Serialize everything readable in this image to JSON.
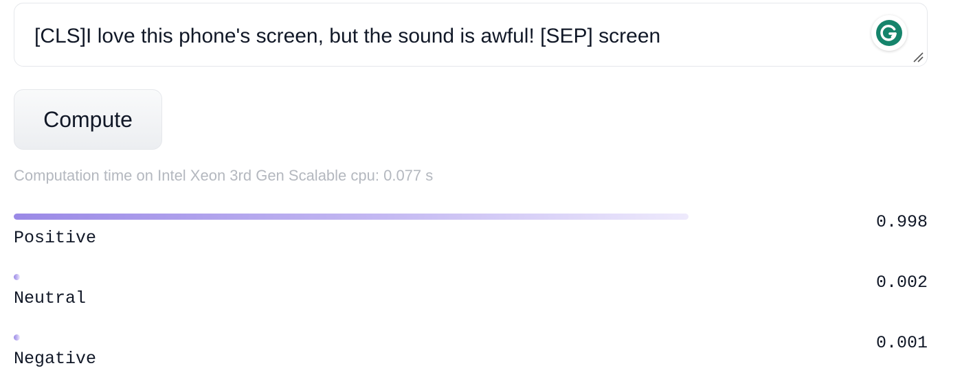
{
  "input": {
    "value": "[CLS]I love this phone's screen, but the sound is awful! [SEP] screen"
  },
  "compute_button": {
    "label": "Compute"
  },
  "computation_time": "Computation time on Intel Xeon 3rd Gen Scalable cpu: 0.077 s",
  "colors": {
    "bar_start": "#9a89e6",
    "bar_end": "#eeeafc",
    "grammarly_green": "#15846b"
  },
  "icons": {
    "assistant": "grammarly-icon",
    "resize": "resize-handle-icon"
  },
  "results": [
    {
      "label": "Positive",
      "score_text": "0.998",
      "score": 0.998
    },
    {
      "label": "Neutral",
      "score_text": "0.002",
      "score": 0.002
    },
    {
      "label": "Negative",
      "score_text": "0.001",
      "score": 0.001
    }
  ]
}
